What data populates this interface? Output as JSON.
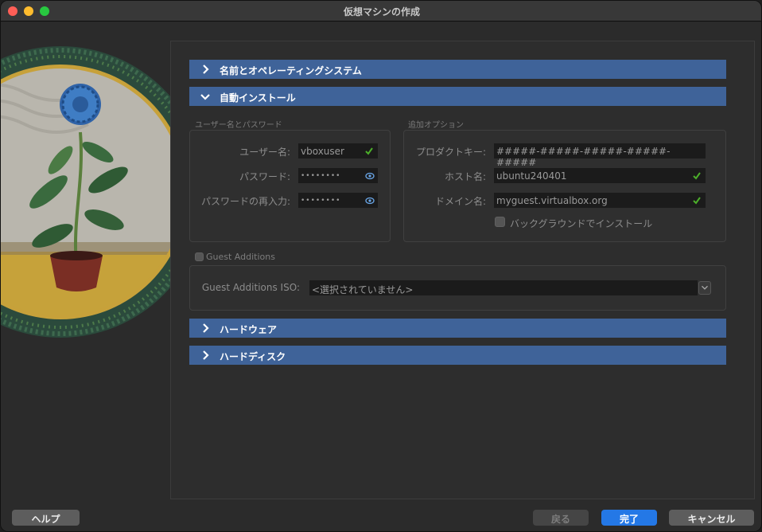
{
  "window": {
    "title": "仮想マシンの作成"
  },
  "sections": [
    {
      "label": "名前とオペレーティングシステム",
      "expanded": false
    },
    {
      "label": "自動インストール",
      "expanded": true
    },
    {
      "label": "ハードウェア",
      "expanded": false
    },
    {
      "label": "ハードディスク",
      "expanded": false
    }
  ],
  "credentials": {
    "group_title": "ユーザー名とパスワード",
    "username_label": "ユーザー名:",
    "username_value": "vboxuser",
    "password_label": "パスワード:",
    "password_value": "••••••••",
    "password_repeat_label": "パスワードの再入力:",
    "password_repeat_value": "••••••••"
  },
  "options": {
    "group_title": "追加オプション",
    "product_key_label": "プロダクトキー:",
    "product_key_value": "#####-#####-#####-#####-#####",
    "hostname_label": "ホスト名:",
    "hostname_value": "ubuntu240401",
    "domain_label": "ドメイン名:",
    "domain_value": "myguest.virtualbox.org",
    "background_install_label": "バックグラウンドでインストール",
    "background_install_checked": false
  },
  "guest_additions": {
    "checkbox_label": "Guest Additions",
    "checked": false,
    "iso_label": "Guest Additions ISO:",
    "iso_value": "<選択されていません>"
  },
  "buttons": {
    "help": "ヘルプ",
    "back": "戻る",
    "finish": "完了",
    "cancel": "キャンセル"
  },
  "colors": {
    "section_header": "#3f6399",
    "primary_button": "#2478e6",
    "ok_check": "#4caf2a"
  }
}
